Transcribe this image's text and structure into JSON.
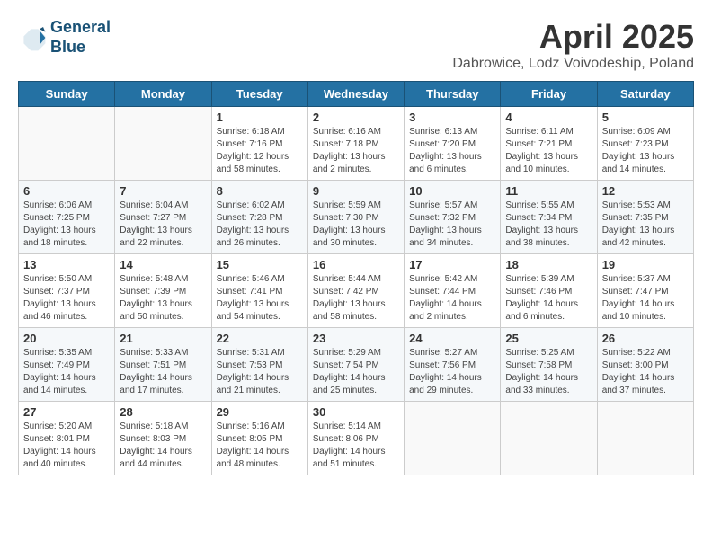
{
  "header": {
    "logo_line1": "General",
    "logo_line2": "Blue",
    "month": "April 2025",
    "location": "Dabrowice, Lodz Voivodeship, Poland"
  },
  "days_of_week": [
    "Sunday",
    "Monday",
    "Tuesday",
    "Wednesday",
    "Thursday",
    "Friday",
    "Saturday"
  ],
  "weeks": [
    [
      {
        "day": "",
        "sunrise": "",
        "sunset": "",
        "daylight": ""
      },
      {
        "day": "",
        "sunrise": "",
        "sunset": "",
        "daylight": ""
      },
      {
        "day": "1",
        "sunrise": "Sunrise: 6:18 AM",
        "sunset": "Sunset: 7:16 PM",
        "daylight": "Daylight: 12 hours and 58 minutes."
      },
      {
        "day": "2",
        "sunrise": "Sunrise: 6:16 AM",
        "sunset": "Sunset: 7:18 PM",
        "daylight": "Daylight: 13 hours and 2 minutes."
      },
      {
        "day": "3",
        "sunrise": "Sunrise: 6:13 AM",
        "sunset": "Sunset: 7:20 PM",
        "daylight": "Daylight: 13 hours and 6 minutes."
      },
      {
        "day": "4",
        "sunrise": "Sunrise: 6:11 AM",
        "sunset": "Sunset: 7:21 PM",
        "daylight": "Daylight: 13 hours and 10 minutes."
      },
      {
        "day": "5",
        "sunrise": "Sunrise: 6:09 AM",
        "sunset": "Sunset: 7:23 PM",
        "daylight": "Daylight: 13 hours and 14 minutes."
      }
    ],
    [
      {
        "day": "6",
        "sunrise": "Sunrise: 6:06 AM",
        "sunset": "Sunset: 7:25 PM",
        "daylight": "Daylight: 13 hours and 18 minutes."
      },
      {
        "day": "7",
        "sunrise": "Sunrise: 6:04 AM",
        "sunset": "Sunset: 7:27 PM",
        "daylight": "Daylight: 13 hours and 22 minutes."
      },
      {
        "day": "8",
        "sunrise": "Sunrise: 6:02 AM",
        "sunset": "Sunset: 7:28 PM",
        "daylight": "Daylight: 13 hours and 26 minutes."
      },
      {
        "day": "9",
        "sunrise": "Sunrise: 5:59 AM",
        "sunset": "Sunset: 7:30 PM",
        "daylight": "Daylight: 13 hours and 30 minutes."
      },
      {
        "day": "10",
        "sunrise": "Sunrise: 5:57 AM",
        "sunset": "Sunset: 7:32 PM",
        "daylight": "Daylight: 13 hours and 34 minutes."
      },
      {
        "day": "11",
        "sunrise": "Sunrise: 5:55 AM",
        "sunset": "Sunset: 7:34 PM",
        "daylight": "Daylight: 13 hours and 38 minutes."
      },
      {
        "day": "12",
        "sunrise": "Sunrise: 5:53 AM",
        "sunset": "Sunset: 7:35 PM",
        "daylight": "Daylight: 13 hours and 42 minutes."
      }
    ],
    [
      {
        "day": "13",
        "sunrise": "Sunrise: 5:50 AM",
        "sunset": "Sunset: 7:37 PM",
        "daylight": "Daylight: 13 hours and 46 minutes."
      },
      {
        "day": "14",
        "sunrise": "Sunrise: 5:48 AM",
        "sunset": "Sunset: 7:39 PM",
        "daylight": "Daylight: 13 hours and 50 minutes."
      },
      {
        "day": "15",
        "sunrise": "Sunrise: 5:46 AM",
        "sunset": "Sunset: 7:41 PM",
        "daylight": "Daylight: 13 hours and 54 minutes."
      },
      {
        "day": "16",
        "sunrise": "Sunrise: 5:44 AM",
        "sunset": "Sunset: 7:42 PM",
        "daylight": "Daylight: 13 hours and 58 minutes."
      },
      {
        "day": "17",
        "sunrise": "Sunrise: 5:42 AM",
        "sunset": "Sunset: 7:44 PM",
        "daylight": "Daylight: 14 hours and 2 minutes."
      },
      {
        "day": "18",
        "sunrise": "Sunrise: 5:39 AM",
        "sunset": "Sunset: 7:46 PM",
        "daylight": "Daylight: 14 hours and 6 minutes."
      },
      {
        "day": "19",
        "sunrise": "Sunrise: 5:37 AM",
        "sunset": "Sunset: 7:47 PM",
        "daylight": "Daylight: 14 hours and 10 minutes."
      }
    ],
    [
      {
        "day": "20",
        "sunrise": "Sunrise: 5:35 AM",
        "sunset": "Sunset: 7:49 PM",
        "daylight": "Daylight: 14 hours and 14 minutes."
      },
      {
        "day": "21",
        "sunrise": "Sunrise: 5:33 AM",
        "sunset": "Sunset: 7:51 PM",
        "daylight": "Daylight: 14 hours and 17 minutes."
      },
      {
        "day": "22",
        "sunrise": "Sunrise: 5:31 AM",
        "sunset": "Sunset: 7:53 PM",
        "daylight": "Daylight: 14 hours and 21 minutes."
      },
      {
        "day": "23",
        "sunrise": "Sunrise: 5:29 AM",
        "sunset": "Sunset: 7:54 PM",
        "daylight": "Daylight: 14 hours and 25 minutes."
      },
      {
        "day": "24",
        "sunrise": "Sunrise: 5:27 AM",
        "sunset": "Sunset: 7:56 PM",
        "daylight": "Daylight: 14 hours and 29 minutes."
      },
      {
        "day": "25",
        "sunrise": "Sunrise: 5:25 AM",
        "sunset": "Sunset: 7:58 PM",
        "daylight": "Daylight: 14 hours and 33 minutes."
      },
      {
        "day": "26",
        "sunrise": "Sunrise: 5:22 AM",
        "sunset": "Sunset: 8:00 PM",
        "daylight": "Daylight: 14 hours and 37 minutes."
      }
    ],
    [
      {
        "day": "27",
        "sunrise": "Sunrise: 5:20 AM",
        "sunset": "Sunset: 8:01 PM",
        "daylight": "Daylight: 14 hours and 40 minutes."
      },
      {
        "day": "28",
        "sunrise": "Sunrise: 5:18 AM",
        "sunset": "Sunset: 8:03 PM",
        "daylight": "Daylight: 14 hours and 44 minutes."
      },
      {
        "day": "29",
        "sunrise": "Sunrise: 5:16 AM",
        "sunset": "Sunset: 8:05 PM",
        "daylight": "Daylight: 14 hours and 48 minutes."
      },
      {
        "day": "30",
        "sunrise": "Sunrise: 5:14 AM",
        "sunset": "Sunset: 8:06 PM",
        "daylight": "Daylight: 14 hours and 51 minutes."
      },
      {
        "day": "",
        "sunrise": "",
        "sunset": "",
        "daylight": ""
      },
      {
        "day": "",
        "sunrise": "",
        "sunset": "",
        "daylight": ""
      },
      {
        "day": "",
        "sunrise": "",
        "sunset": "",
        "daylight": ""
      }
    ]
  ]
}
